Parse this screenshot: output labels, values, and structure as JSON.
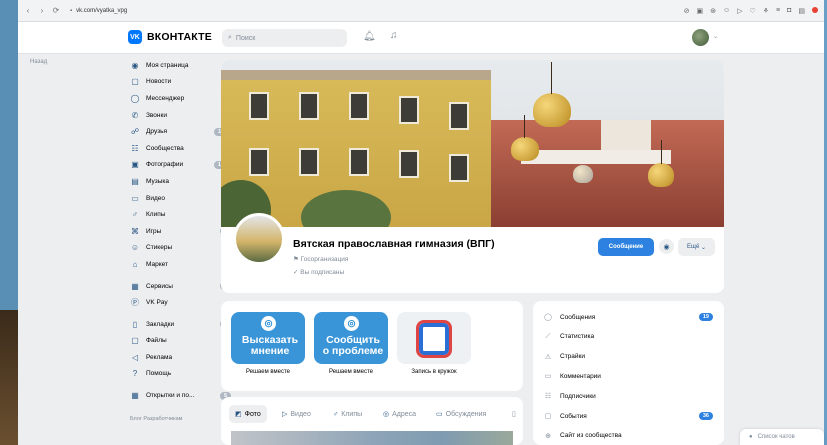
{
  "browser": {
    "url": "vk.com/vyatka_vpg",
    "nav": [
      "‹",
      "›",
      "⟳"
    ]
  },
  "header": {
    "logo_text": "ВКОНТАКТЕ",
    "search_placeholder": "Поиск"
  },
  "back_label": "Назад",
  "sidebar": {
    "items": [
      {
        "label": "Моя страница",
        "icon": "user-circle-icon",
        "glyph": "◉"
      },
      {
        "label": "Новости",
        "icon": "news-icon",
        "glyph": "▢"
      },
      {
        "label": "Мессенджер",
        "icon": "chat-bubble-icon",
        "glyph": "◯"
      },
      {
        "label": "Звонки",
        "icon": "phone-icon",
        "glyph": "✆"
      },
      {
        "label": "Друзья",
        "icon": "friends-icon",
        "glyph": "☍",
        "count": "118"
      },
      {
        "label": "Сообщества",
        "icon": "communities-icon",
        "glyph": "☷"
      },
      {
        "label": "Фотографии",
        "icon": "photo-icon",
        "glyph": "▣",
        "count": "156"
      },
      {
        "label": "Музыка",
        "icon": "music-icon",
        "glyph": "▤"
      },
      {
        "label": "Видео",
        "icon": "video-icon",
        "glyph": "▭"
      },
      {
        "label": "Клипы",
        "icon": "clips-icon",
        "glyph": "♂"
      },
      {
        "label": "Игры",
        "icon": "gamepad-icon",
        "glyph": "⌘",
        "count": "4"
      },
      {
        "label": "Стикеры",
        "icon": "sticker-icon",
        "glyph": "☺"
      },
      {
        "label": "Маркет",
        "icon": "market-icon",
        "glyph": "⌂"
      }
    ],
    "items2": [
      {
        "label": "Сервисы",
        "icon": "services-icon",
        "glyph": "▦",
        "count": "5"
      },
      {
        "label": "VK Pay",
        "icon": "vkpay-icon",
        "glyph": "Ⓟ"
      }
    ],
    "items3": [
      {
        "label": "Закладки",
        "icon": "bookmark-icon",
        "glyph": "▯",
        "count": "5"
      },
      {
        "label": "Файлы",
        "icon": "files-icon",
        "glyph": "▢"
      },
      {
        "label": "Реклама",
        "icon": "ads-icon",
        "glyph": "◁"
      },
      {
        "label": "Помощь",
        "icon": "help-icon",
        "glyph": "?"
      }
    ],
    "items4": [
      {
        "label": "Открытки и по...",
        "icon": "apps-icon",
        "glyph": "▦",
        "count": "5"
      }
    ],
    "footer": "Блог   Разработчикам"
  },
  "group": {
    "name": "Вятская православная гимназия (ВПГ)",
    "type": "Госорганизация",
    "subscribed": "Вы подписаны",
    "message_button": "Сообщение",
    "more_button": "Ещё"
  },
  "actions": [
    {
      "line1": "Высказать",
      "line2": "мнение",
      "caption": "Решаем вместе",
      "color": "#3a95d8"
    },
    {
      "line1": "Сообщить",
      "line2": "о проблеме",
      "caption": "Решаем вместе",
      "color": "#3a95d8"
    },
    {
      "line1": "",
      "line2": "",
      "caption": "Запись в кружок",
      "color": "#eef1f4"
    }
  ],
  "tabs": [
    {
      "label": "Фото",
      "icon": "photo-icon",
      "glyph": "◩"
    },
    {
      "label": "Видео",
      "icon": "video-icon",
      "glyph": "▷"
    },
    {
      "label": "Клипы",
      "icon": "clips-icon",
      "glyph": "♂"
    },
    {
      "label": "Адреса",
      "icon": "location-icon",
      "glyph": "◎"
    },
    {
      "label": "Обсуждения",
      "icon": "discussion-icon",
      "glyph": "▭"
    }
  ],
  "menu": [
    {
      "label": "Сообщения",
      "icon": "message-icon",
      "glyph": "◯",
      "count": "19"
    },
    {
      "label": "Статистика",
      "icon": "stats-icon",
      "glyph": "⟋"
    },
    {
      "label": "Страйки",
      "icon": "warning-icon",
      "glyph": "⚠"
    },
    {
      "label": "Комментарии",
      "icon": "comment-icon",
      "glyph": "▭"
    },
    {
      "label": "Подписчики",
      "icon": "subscribers-icon",
      "glyph": "☷"
    },
    {
      "label": "События",
      "icon": "events-icon",
      "glyph": "▢",
      "count": "36"
    },
    {
      "label": "Сайт из сообщества",
      "icon": "globe-icon",
      "glyph": "⊕"
    }
  ],
  "chat_list_label": "Список чатов"
}
